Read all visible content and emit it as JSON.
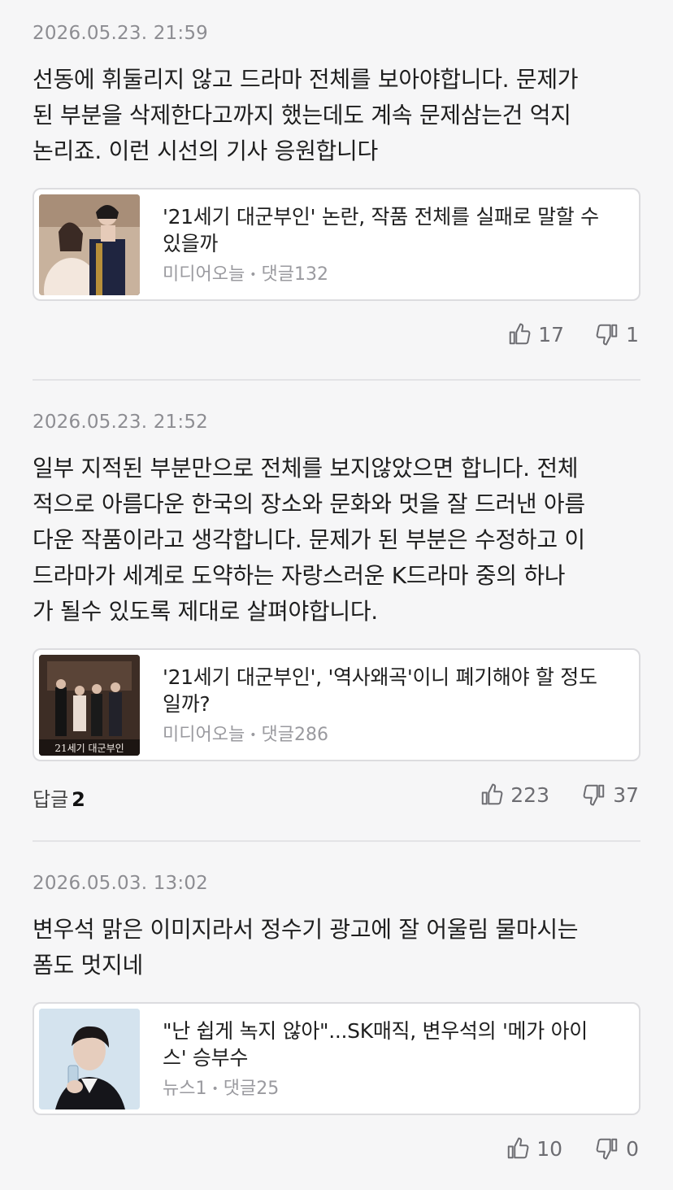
{
  "comments": [
    {
      "timestamp": "2026.05.23. 21:59",
      "lines": [
        "선동에 휘둘리지 않고 드라마 전체를 보아야합니다. 문제가",
        "된 부분을 삭제한다고까지 했는데도 계속 문제삼는건 억지",
        "논리죠. 이런 시선의 기사 응원합니다"
      ],
      "card": {
        "title_lines": [
          "'21세기 대군부인' 논란, 작품 전체를 실패로 말할 수",
          "있을까"
        ],
        "source": "미디어오늘",
        "comments": "댓글132"
      },
      "likes": "17",
      "dislikes": "1"
    },
    {
      "timestamp": "2026.05.23. 21:52",
      "lines": [
        "일부 지적된 부분만으로 전체를 보지않았으면 합니다. 전체",
        "적으로 아름다운 한국의 장소와 문화와 멋을 잘 드러낸 아름",
        "다운 작품이라고 생각합니다. 문제가 된 부분은 수정하고 이",
        "드라마가 세계로 도약하는 자랑스러운 K드라마 중의 하나",
        "가 될수 있도록 제대로 살펴야합니다."
      ],
      "card": {
        "title_lines": [
          "'21세기 대군부인', '역사왜곡'이니 폐기해야 할 정도",
          "일까?"
        ],
        "source": "미디어오늘",
        "comments": "댓글286",
        "poster_text": "21세기 대군부인"
      },
      "reply_label": "답글",
      "reply_count": "2",
      "likes": "223",
      "dislikes": "37"
    },
    {
      "timestamp": "2026.05.03. 13:02",
      "lines": [
        "변우석 맑은 이미지라서 정수기 광고에 잘 어울림 물마시는",
        "폼도 멋지네"
      ],
      "card": {
        "title_lines": [
          "\"난 쉽게 녹지 않아\"...SK매직, 변우석의 '메가 아이",
          "스' 승부수"
        ],
        "source": "뉴스1",
        "comments": "댓글25"
      },
      "likes": "10",
      "dislikes": "0"
    }
  ],
  "icons": {
    "like": "thumbs-up-icon",
    "dislike": "thumbs-down-icon"
  }
}
